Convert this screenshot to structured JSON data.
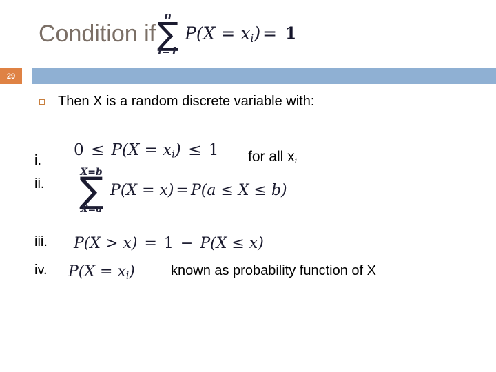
{
  "slide": {
    "page_number": "29",
    "title": "Condition if",
    "title_formula": {
      "sigma_upper": "n",
      "sigma_lower": "i=1",
      "summand": "P(X = x",
      "summand_sub": "i",
      "summand_close": ")",
      "equals": "=",
      "result": "1"
    },
    "intro_bullet": "Then X is a random discrete variable with:",
    "items": [
      {
        "label": "i.",
        "formula": {
          "lhs": "0",
          "rel1": "≤",
          "mid": "P(X = x",
          "mid_sub": "i",
          "mid_close": ")",
          "rel2": "≤",
          "rhs": "1"
        },
        "trailing_text": "for all x",
        "trailing_sub": "i"
      },
      {
        "label": "ii.",
        "formula": {
          "sigma_upper": "X=b",
          "sigma_lower": "X=a",
          "summand": "P(X = x",
          "summand_close": ")",
          "equals": "=",
          "rhs": "P(a ≤ X ≤ b)"
        }
      },
      {
        "label": "iii.",
        "formula": {
          "lhs": "P(X > x)",
          "equals": "=",
          "rhs_num": "1",
          "minus": "−",
          "rhs_expr": "P(X ≤ x)"
        }
      },
      {
        "label": "iv.",
        "formula": {
          "expr": "P(X = x",
          "expr_sub": "i",
          "expr_close": ")"
        },
        "trailing_text": "known as probability function of X"
      }
    ],
    "colors": {
      "title": "#7b6f66",
      "badge_bg": "#df8244",
      "bar_bg": "#8fb0d3",
      "bullet_border": "#c87f3f",
      "body_text": "#000000"
    }
  }
}
